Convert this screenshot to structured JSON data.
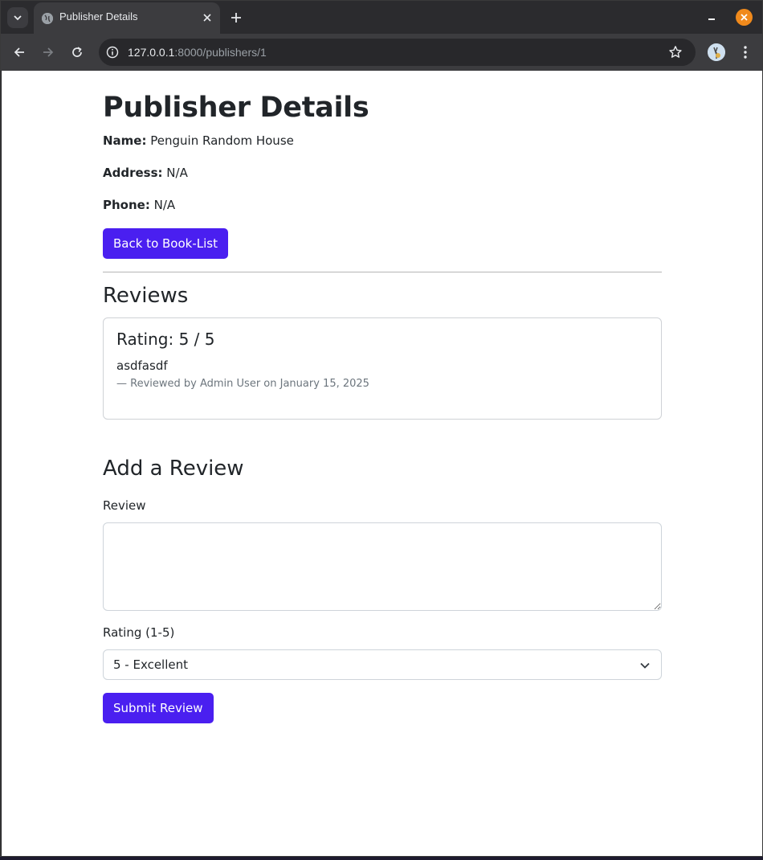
{
  "browser": {
    "tab_title": "Publisher Details",
    "url_host": "127.0.0.1",
    "url_rest": ":8000/publishers/1"
  },
  "page": {
    "title": "Publisher Details",
    "name_label": "Name:",
    "name_value": "Penguin Random House",
    "address_label": "Address:",
    "address_value": "N/A",
    "phone_label": "Phone:",
    "phone_value": "N/A",
    "back_button": "Back to Book-List"
  },
  "reviews": {
    "heading": "Reviews",
    "items": [
      {
        "rating": "Rating: 5 / 5",
        "text": "asdfasdf",
        "meta": "— Reviewed by Admin User on January 15, 2025"
      }
    ]
  },
  "add_review": {
    "heading": "Add a Review",
    "review_label": "Review",
    "review_value": "",
    "rating_label": "Rating (1-5)",
    "rating_selected": "5 - Excellent",
    "submit_button": "Submit Review"
  },
  "colors": {
    "primary": "#4a1ff0",
    "window_close": "#f08a1c"
  }
}
